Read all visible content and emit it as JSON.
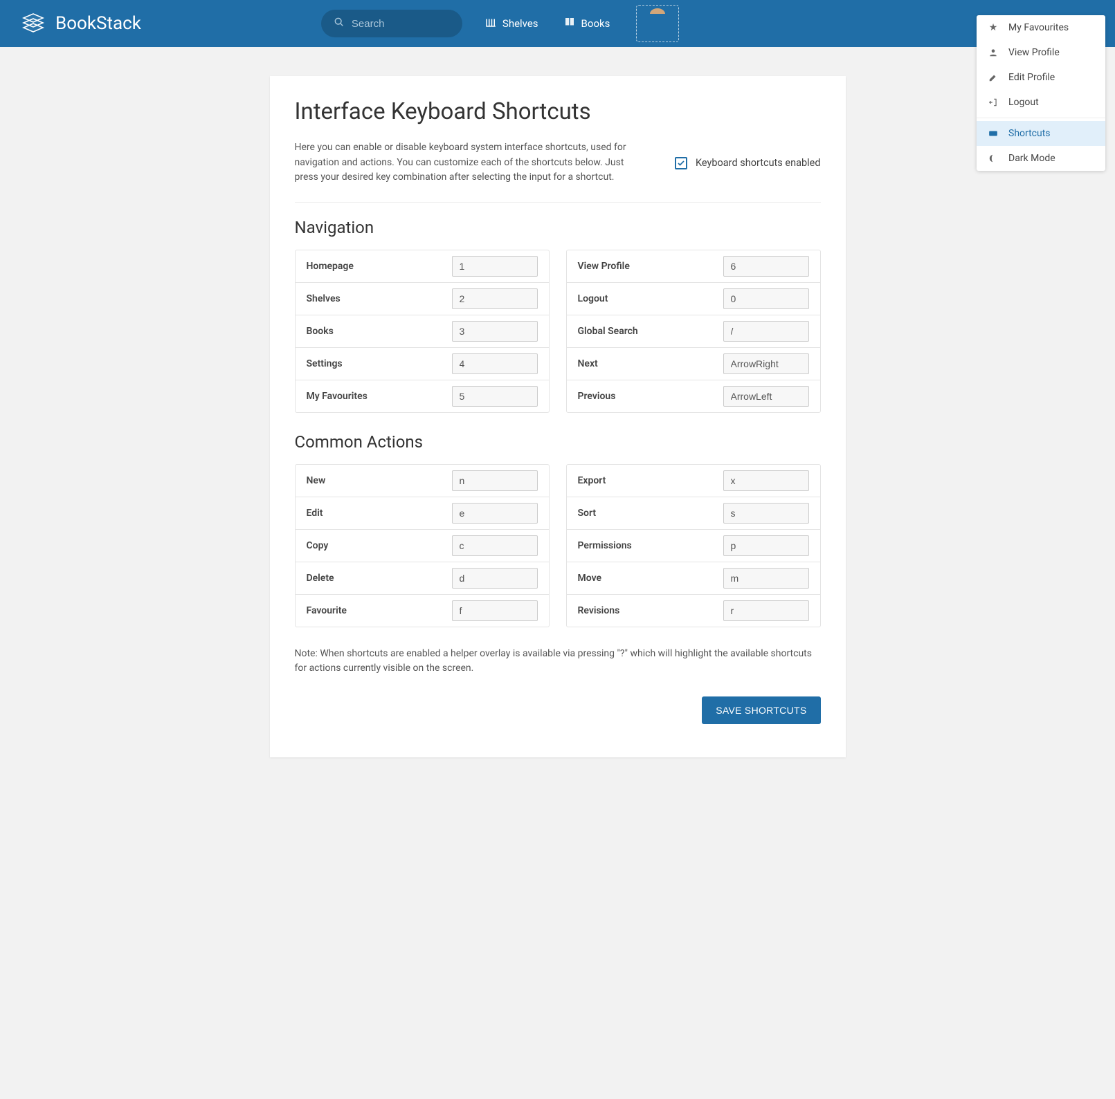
{
  "header": {
    "brand": "BookStack",
    "search_placeholder": "Search",
    "nav": {
      "shelves": "Shelves",
      "books": "Books"
    }
  },
  "dropdown": {
    "favourites": "My Favourites",
    "view_profile": "View Profile",
    "edit_profile": "Edit Profile",
    "logout": "Logout",
    "shortcuts": "Shortcuts",
    "dark_mode": "Dark Mode"
  },
  "page": {
    "title": "Interface Keyboard Shortcuts",
    "intro": "Here you can enable or disable keyboard system interface shortcuts, used for navigation and actions. You can customize each of the shortcuts below. Just press your desired key combination after selecting the input for a shortcut.",
    "enabled_label": "Keyboard shortcuts enabled",
    "note": "Note: When shortcuts are enabled a helper overlay is available via pressing \"?\" which will highlight the available shortcuts for actions currently visible on the screen.",
    "save": "SAVE SHORTCUTS"
  },
  "sections": {
    "navigation": {
      "title": "Navigation",
      "left": [
        {
          "label": "Homepage",
          "value": "1"
        },
        {
          "label": "Shelves",
          "value": "2"
        },
        {
          "label": "Books",
          "value": "3"
        },
        {
          "label": "Settings",
          "value": "4"
        },
        {
          "label": "My Favourites",
          "value": "5"
        }
      ],
      "right": [
        {
          "label": "View Profile",
          "value": "6"
        },
        {
          "label": "Logout",
          "value": "0"
        },
        {
          "label": "Global Search",
          "value": "/"
        },
        {
          "label": "Next",
          "value": "ArrowRight"
        },
        {
          "label": "Previous",
          "value": "ArrowLeft"
        }
      ]
    },
    "actions": {
      "title": "Common Actions",
      "left": [
        {
          "label": "New",
          "value": "n"
        },
        {
          "label": "Edit",
          "value": "e"
        },
        {
          "label": "Copy",
          "value": "c"
        },
        {
          "label": "Delete",
          "value": "d"
        },
        {
          "label": "Favourite",
          "value": "f"
        }
      ],
      "right": [
        {
          "label": "Export",
          "value": "x"
        },
        {
          "label": "Sort",
          "value": "s"
        },
        {
          "label": "Permissions",
          "value": "p"
        },
        {
          "label": "Move",
          "value": "m"
        },
        {
          "label": "Revisions",
          "value": "r"
        }
      ]
    }
  }
}
